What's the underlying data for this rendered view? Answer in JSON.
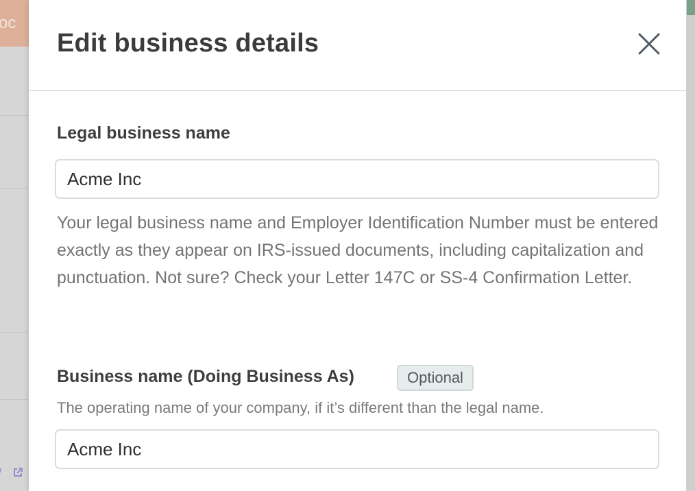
{
  "background": {
    "banner_text": "roc"
  },
  "modal": {
    "title": "Edit business details",
    "close_icon": "close-icon",
    "fields": {
      "legal_name": {
        "label": "Legal business name",
        "value": "Acme Inc",
        "help": "Your legal business name and Employer Identification Number must be entered exactly as they appear on IRS-issued documents, including capitalization and punctuation. Not sure? Check your Letter 147C or SS-4 Confirmation Letter."
      },
      "dba_name": {
        "label": "Business name (Doing Business As)",
        "badge": "Optional",
        "help": "The operating name of your company, if it’s different than the legal name.",
        "value": "Acme Inc"
      }
    }
  },
  "colors": {
    "title": "#3b3b3b",
    "help_text": "#747474",
    "badge_bg": "#e7eced",
    "input_border": "#dcdcdc"
  }
}
